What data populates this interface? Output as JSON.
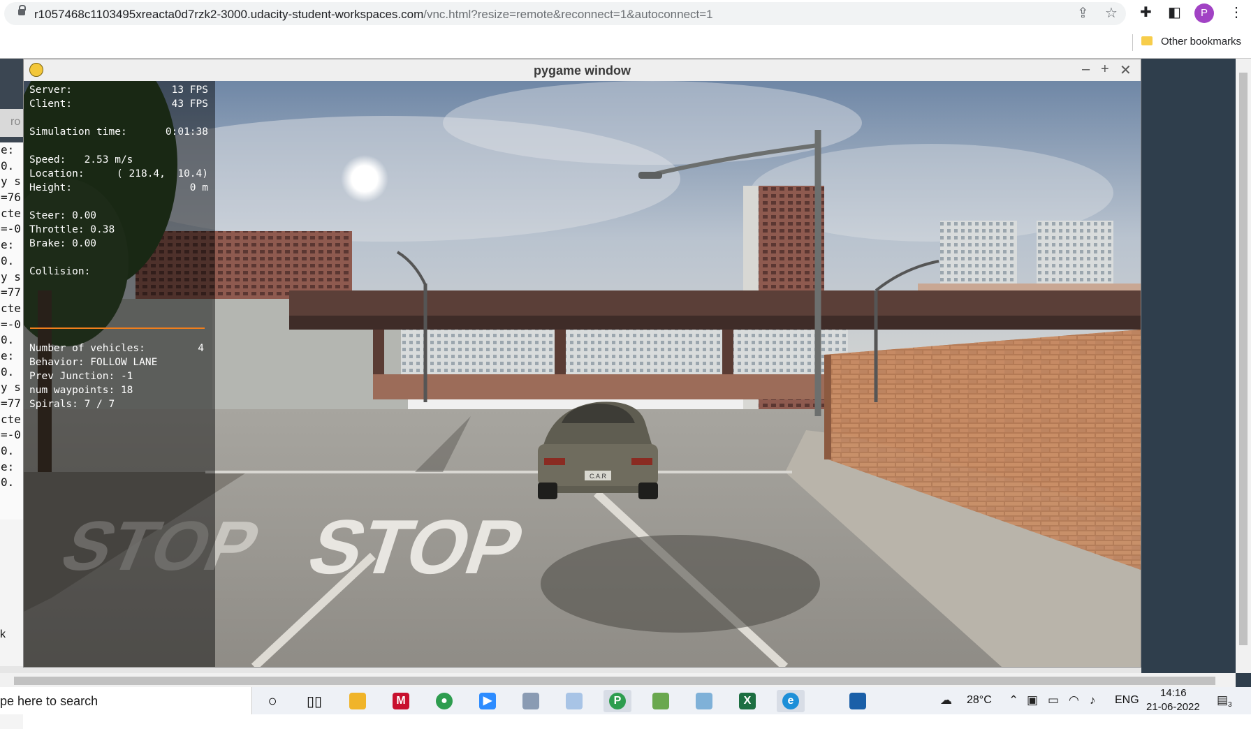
{
  "browser": {
    "url_host": "r1057468c1103495xreacta0d7rzk2-3000.udacity-student-workspaces.com",
    "url_path": "/vnc.html?resize=remote&reconnect=1&autoconnect=1",
    "profile_initial": "P",
    "bookmark_label": "Other bookmarks"
  },
  "terminal": {
    "tab_fragment": "ro",
    "lines": [
      "e:",
      " 0.",
      "y s",
      "=76",
      "cte",
      "=-0",
      "e:",
      " 0.",
      "y s",
      "=77",
      "cte",
      "=-0",
      " 0.",
      "e:",
      " 0.",
      "y s",
      "=77",
      "cte",
      "=-0",
      " 0.",
      "e:",
      " 0."
    ],
    "bottom_char": "k"
  },
  "pygame": {
    "title": "pygame window",
    "hud": {
      "server_label": "Server:",
      "server_value": "13 FPS",
      "client_label": "Client:",
      "client_value": "43 FPS",
      "sim_time_label": "Simulation time:",
      "sim_time_value": "0:01:38",
      "speed_line": "Speed:   2.53 m/s",
      "location_label": "Location:",
      "location_value": "( 218.4,  10.4)",
      "height_label": "Height:",
      "height_value": "0 m",
      "steer_line": "Steer: 0.00",
      "throttle_line": "Throttle: 0.38",
      "brake_line": "Brake: 0.00",
      "collision_label": "Collision:",
      "vehicles_label": "Number of vehicles:",
      "vehicles_value": "4",
      "behavior_line": "Behavior: FOLLOW LANE",
      "junction_line": "Prev Junction: -1",
      "waypoints_line": "num waypoints: 18",
      "spirals_line": "Spirals: 7 / 7"
    },
    "road_text": "STOP",
    "plate_text": "C.A.R"
  },
  "taskbar": {
    "search_placeholder": "pe here to search",
    "weather": "28°C",
    "language": "ENG",
    "time": "14:16",
    "date": "21-06-2022",
    "notification_count": "3"
  }
}
